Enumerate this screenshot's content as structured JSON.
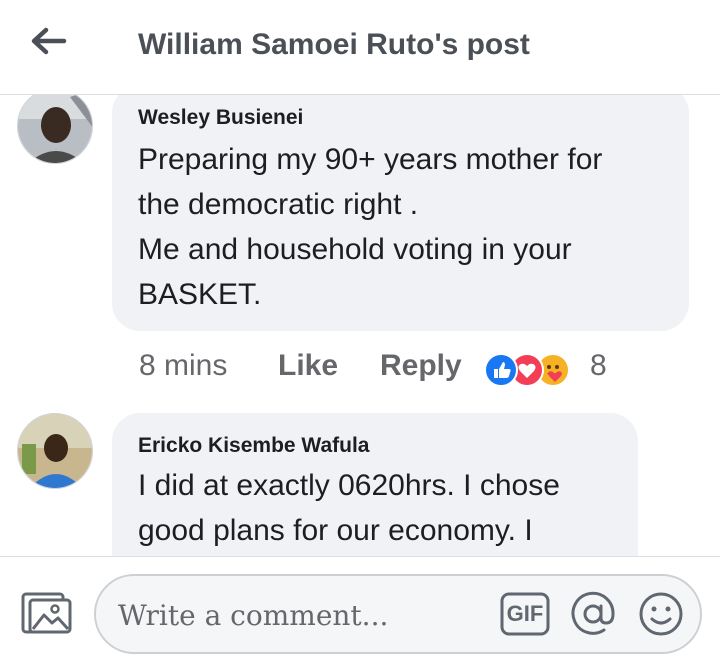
{
  "header": {
    "title": "William Samoei Ruto's post",
    "back_icon": "arrow-left-icon"
  },
  "comments": [
    {
      "author": "Wesley Busienei",
      "lines": [
        "Preparing my 90+ years mother for",
        "the democratic right .",
        "Me and household voting in your",
        "BASKET."
      ],
      "time": "8 mins",
      "like_label": "Like",
      "reply_label": "Reply",
      "reaction_icons": [
        "like-reaction-icon",
        "love-reaction-icon",
        "care-reaction-icon"
      ],
      "reaction_count": "8"
    },
    {
      "author": "Ericko Kisembe Wafula",
      "lines": [
        "I did at exactly 0620hrs. I chose",
        "good plans for our economy. I"
      ]
    }
  ],
  "composer": {
    "placeholder": "Write a comment...",
    "photo_icon": "photo-icon",
    "gif_label": "GIF",
    "at_icon": "mention-icon",
    "emoji_icon": "emoji-icon"
  },
  "colors": {
    "bubble": "#f0f2f5",
    "meta_text": "#65676b",
    "header_title": "#4b4f56",
    "like_blue": "#1877f2",
    "love_red": "#f33e58",
    "care_yellow": "#f7b125"
  }
}
